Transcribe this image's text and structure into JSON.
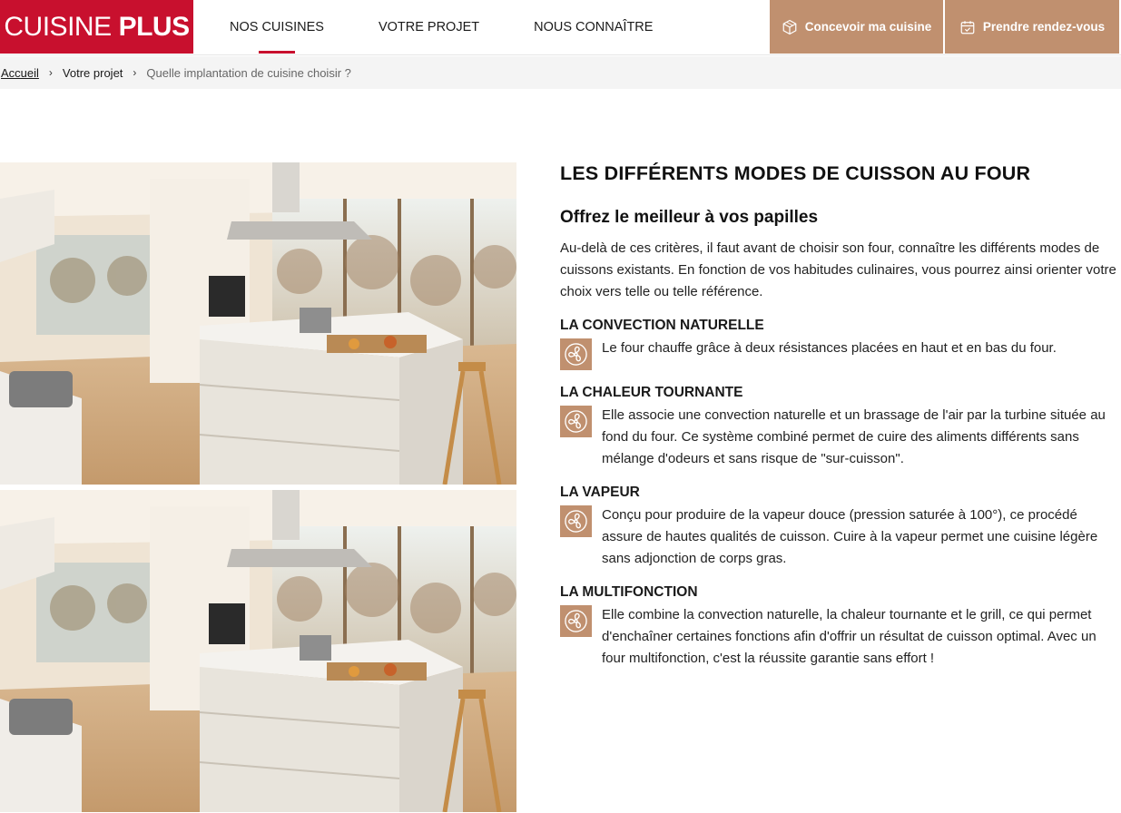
{
  "header": {
    "logo_part1": "CUISINE",
    "logo_part2": "PLUS",
    "nav": [
      "NOS CUISINES",
      "VOTRE PROJET",
      "NOUS CONNAÎTRE"
    ],
    "cta_design": "Concevoir ma cuisine",
    "cta_appointment": "Prendre rendez-vous",
    "brand_color": "#c8102e",
    "accent_color": "#c0906f"
  },
  "breadcrumb": {
    "home": "Accueil",
    "parent": "Votre projet",
    "current": "Quelle implantation de cuisine choisir ?"
  },
  "article": {
    "title": "LES DIFFÉRENTS MODES DE CUISSON AU FOUR",
    "subtitle": "Offrez le meilleur à vos papilles",
    "intro": "Au-delà de ces critères, il faut avant de choisir son four, connaître les différents modes de cuissons existants. En fonction de vos habitudes culinaires, vous pourrez ainsi orienter votre choix vers telle ou telle référence.",
    "modes": [
      {
        "title": "LA CONVECTION NATURELLE",
        "icon": "fan-icon",
        "text": "Le four chauffe grâce à deux résistances placées en haut et en bas du four."
      },
      {
        "title": "LA CHALEUR TOURNANTE",
        "icon": "fan-icon",
        "text": "Elle associe une convection naturelle et un brassage de l'air par la turbine située au fond du four. Ce système combiné permet de cuire des aliments différents sans mélange d'odeurs et sans risque de \"sur-cuisson\"."
      },
      {
        "title": "LA VAPEUR",
        "icon": "fan-icon",
        "text": "Conçu pour produire de la vapeur douce (pression saturée à 100°), ce procédé assure de hautes qualités de cuisson. Cuire à la vapeur permet une cuisine légère sans adjonction de corps gras."
      },
      {
        "title": "LA MULTIFONCTION",
        "icon": "fan-icon",
        "text": "Elle combine la convection naturelle, la chaleur tournante et le grill, ce qui permet d'enchaîner certaines fonctions afin d'offrir un résultat de cuisson optimal. Avec un four multifonction, c'est la réussite garantie sans effort !"
      }
    ]
  }
}
